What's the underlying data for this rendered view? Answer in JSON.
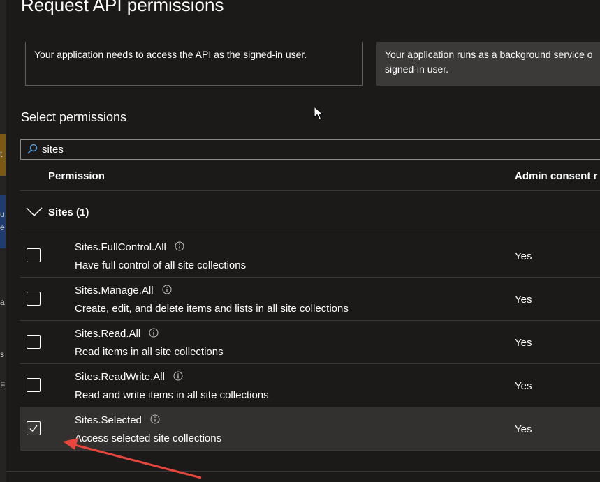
{
  "panel": {
    "title": "Request API permissions"
  },
  "cards": {
    "delegated": {
      "text": "Your application needs to access the API as the signed-in user."
    },
    "application": {
      "line1": "Your application runs as a background service o",
      "line2": "signed-in user."
    }
  },
  "select_permissions": {
    "title": "Select permissions",
    "search_value": "sites",
    "columns": {
      "permission": "Permission",
      "admin_consent": "Admin consent r"
    }
  },
  "group": {
    "label": "Sites (1)",
    "expanded": true
  },
  "permissions": [
    {
      "name": "Sites.FullControl.All",
      "description": "Have full control of all site collections",
      "admin": "Yes",
      "checked": false
    },
    {
      "name": "Sites.Manage.All",
      "description": "Create, edit, and delete items and lists in all site collections",
      "admin": "Yes",
      "checked": false
    },
    {
      "name": "Sites.Read.All",
      "description": "Read items in all site collections",
      "admin": "Yes",
      "checked": false
    },
    {
      "name": "Sites.ReadWrite.All",
      "description": "Read and write items in all site collections",
      "admin": "Yes",
      "checked": false
    },
    {
      "name": "Sites.Selected",
      "description": "Access selected site collections",
      "admin": "Yes",
      "checked": true
    }
  ],
  "backdrop_fragments": [
    "t",
    "u",
    "e",
    "a",
    "s",
    "F"
  ],
  "icons": {
    "search": "search-icon",
    "chevron": "chevron-down-icon",
    "info": "info-icon",
    "check": "checkmark-icon",
    "cursor": "mouse-cursor-icon",
    "annotation": "red-arrow-annotation"
  },
  "colors": {
    "background": "#1b1a19",
    "selected_row": "#323130",
    "accent_blue": "#4f9fe3",
    "annotation_red": "#e8453c",
    "divider": "#3b3a39"
  }
}
